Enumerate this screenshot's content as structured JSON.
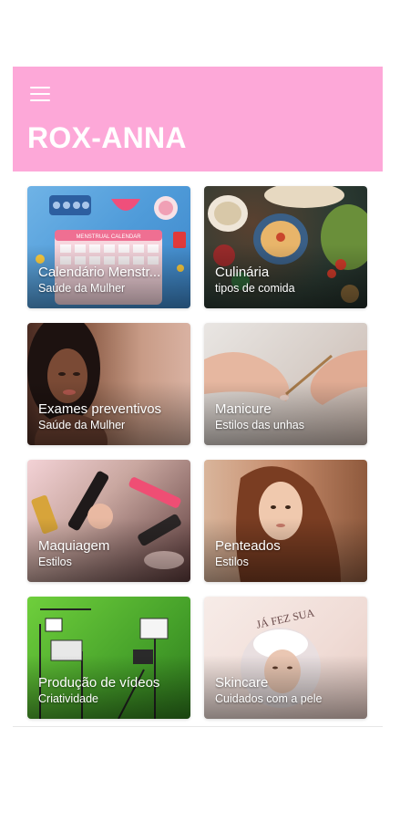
{
  "app": {
    "title": "ROX-ANNA",
    "menu_icon": "menu-icon",
    "appbar_color": "#fda8d8"
  },
  "cards": [
    {
      "title": "Calendário Menstr...",
      "subtitle": "Saúde da Mulher"
    },
    {
      "title": "Culinária",
      "subtitle": "tipos de comida"
    },
    {
      "title": "Exames preventivos",
      "subtitle": "Saúde da Mulher"
    },
    {
      "title": "Manicure",
      "subtitle": "Estilos das unhas"
    },
    {
      "title": "Maquiagem",
      "subtitle": "Estilos"
    },
    {
      "title": "Penteados",
      "subtitle": "Estilos"
    },
    {
      "title": "Produção de vídeos",
      "subtitle": "Criatividade"
    },
    {
      "title": "Skincare",
      "subtitle": "Cuidados com a pele"
    }
  ],
  "card_images": {
    "calendar_header": "MENSTRUAL CALENDAR",
    "skincare_text": "JÁ FEZ SUA"
  }
}
